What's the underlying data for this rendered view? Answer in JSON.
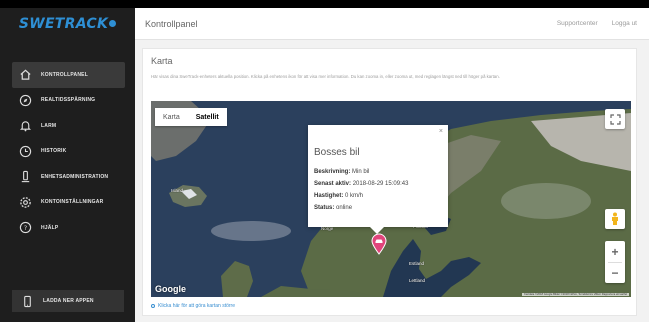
{
  "brand": {
    "logo_text": "SWETRACK"
  },
  "sidebar": {
    "items": [
      {
        "label": "KONTROLLPANEL",
        "icon": "home-icon",
        "active": true
      },
      {
        "label": "REALTIDSSPÅRNING",
        "icon": "compass-icon",
        "active": false
      },
      {
        "label": "LARM",
        "icon": "bell-icon",
        "active": false
      },
      {
        "label": "HISTORIK",
        "icon": "clock-icon",
        "active": false
      },
      {
        "label": "ENHETSADMINISTRATION",
        "icon": "tracker-icon",
        "active": false
      },
      {
        "label": "KONTOINSTÄLLNINGAR",
        "icon": "gear-icon",
        "active": false
      },
      {
        "label": "HJÄLP",
        "icon": "help-icon",
        "active": false
      }
    ],
    "app_button": {
      "label": "LADDA NER APPEN",
      "icon": "phone-icon"
    }
  },
  "header": {
    "title": "Kontrollpanel",
    "support_label": "Supportcenter",
    "logout_label": "Logga ut"
  },
  "card": {
    "title": "Karta",
    "description": "Här visas dina SweTrack-enheters aktuella position. Klicka på enhetens ikon för att visa mer information. Du kan zooma in, eller zooma ut, med reglagen längst ned till höger på kartan.",
    "footer_link": "Klicka här för att göra kartan större"
  },
  "map": {
    "type_options": [
      {
        "label": "Karta",
        "selected": false
      },
      {
        "label": "Satellit",
        "selected": true
      }
    ],
    "zoom_in": "+",
    "zoom_out": "−",
    "google_label": "Google",
    "attribution": "Kartdata ©2018 Google Bilder ©2018 NASA, TerraMetrics  Villkor  Rapportera ett kartfel",
    "places": {
      "iceland": "Island",
      "norway": "Norge",
      "finland": "Finland",
      "estonia": "Estland",
      "latvia": "Lettland"
    },
    "popup": {
      "title": "Bosses bil",
      "close": "×",
      "rows": [
        {
          "label": "Beskrivning:",
          "value": "Min bil"
        },
        {
          "label": "Senast aktiv:",
          "value": "2018-08-29 15:09:43"
        },
        {
          "label": "Hastighet:",
          "value": "0 km/h"
        },
        {
          "label": "Status:",
          "value": "online"
        }
      ]
    },
    "colors": {
      "marker": "#e0457b",
      "ocean": "#2a3f5c",
      "land": "#5d6e48"
    }
  }
}
